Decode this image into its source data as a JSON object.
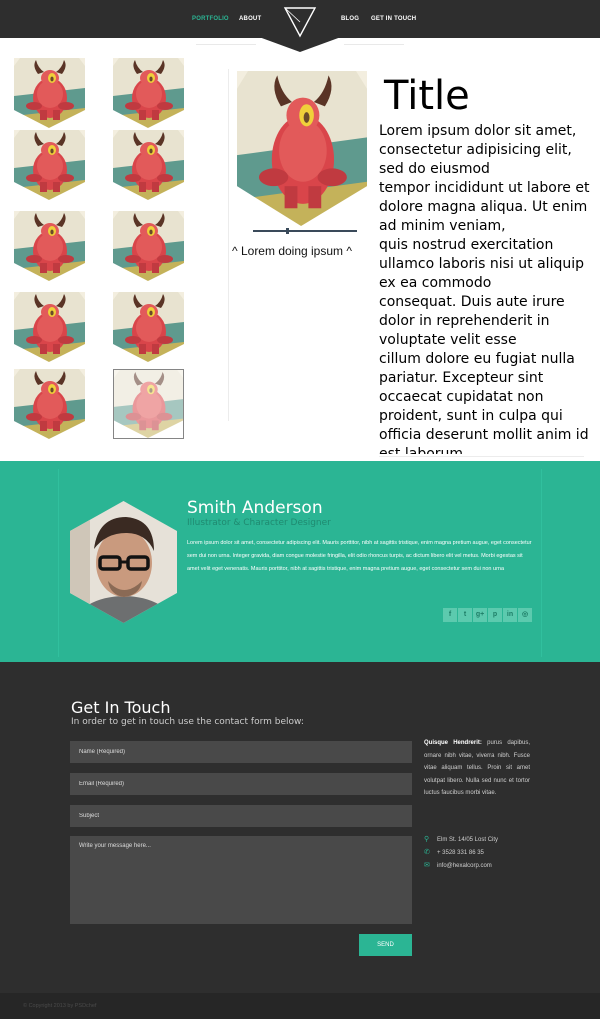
{
  "nav": {
    "items": [
      {
        "label": "PORTFOLIO",
        "active": true
      },
      {
        "label": "ABOUT",
        "active": false
      },
      {
        "label": "BLOG",
        "active": false
      },
      {
        "label": "GET IN TOUCH",
        "active": false
      }
    ],
    "logo_icon": "triangle-logo-icon"
  },
  "portfolio": {
    "thumbnail_count": 10,
    "thumbnail_icon": "red-monster-illustration",
    "selected_index": 9,
    "caption": "^ Lorem doing ipsum ^",
    "title": "Title",
    "body": "Lorem ipsum dolor sit amet, consectetur adipisicing elit, sed do eiusmod\ntempor incididunt ut labore et dolore magna aliqua. Ut enim ad minim veniam,\nquis nostrud exercitation ullamco laboris nisi ut aliquip ex ea commodo\nconsequat. Duis aute irure dolor in reprehenderit in voluptate velit esse\ncillum dolore eu fugiat nulla pariatur. Excepteur sint occaecat cupidatat non\nproident, sunt in culpa qui officia deserunt mollit anim id est laborum"
  },
  "profile": {
    "name": "Smith Anderson",
    "role": "Illustrator & Character Designer",
    "bio": "Lorem ipsum dolor sit amet, consectetur adipiscing elit. Mauris porttitor, nibh at sagittis tristique, enim magna pretium augue, eget consectetur sem dui non urna. Integer gravida, diam congue molestie fringilla, elit odio rhoncus turpis, ac dictum libero elit vel metus. Morbi egestas sit amet velit eget venenatis. Mauris porttitor, nibh at sagittis tristique, enim magna pretium augue, eget consectetur sem dui non urna",
    "social": [
      {
        "glyph": "f",
        "icon": "facebook-icon"
      },
      {
        "glyph": "t",
        "icon": "twitter-icon"
      },
      {
        "glyph": "g+",
        "icon": "google-plus-icon"
      },
      {
        "glyph": "p",
        "icon": "pinterest-icon"
      },
      {
        "glyph": "in",
        "icon": "linkedin-icon"
      },
      {
        "glyph": "◎",
        "icon": "dribbble-icon"
      }
    ]
  },
  "contact": {
    "title": "Get In Touch",
    "subtitle": "In order to get in touch use the contact form below:",
    "name_placeholder": "Name (Required)",
    "email_placeholder": "Email (Required)",
    "subject_placeholder": "Subject",
    "message_placeholder": "Write your message here...",
    "send_label": "SEND",
    "about_label": "Quisque Hendrerit:",
    "about_text": "purus dapibus, ornare nibh vitae, viverra nibh. Fusce vitae aliquam tellus. Proin sit amet volutpat libero. Nulla sed nunc et tortor luctus faucibus morbi vitae.",
    "address": "Elm St. 14/05 Lost City",
    "phone": "+ 3528 331 86 35",
    "email": "info@hexalcorp.com",
    "address_icon": "map-pin-icon",
    "phone_icon": "phone-icon",
    "email_icon": "envelope-icon"
  },
  "footer": {
    "copyright": "© Copyright 2013 by PSDchef"
  },
  "colors": {
    "accent": "#2bb594",
    "dark": "#2e2e2e",
    "field": "#494949"
  }
}
